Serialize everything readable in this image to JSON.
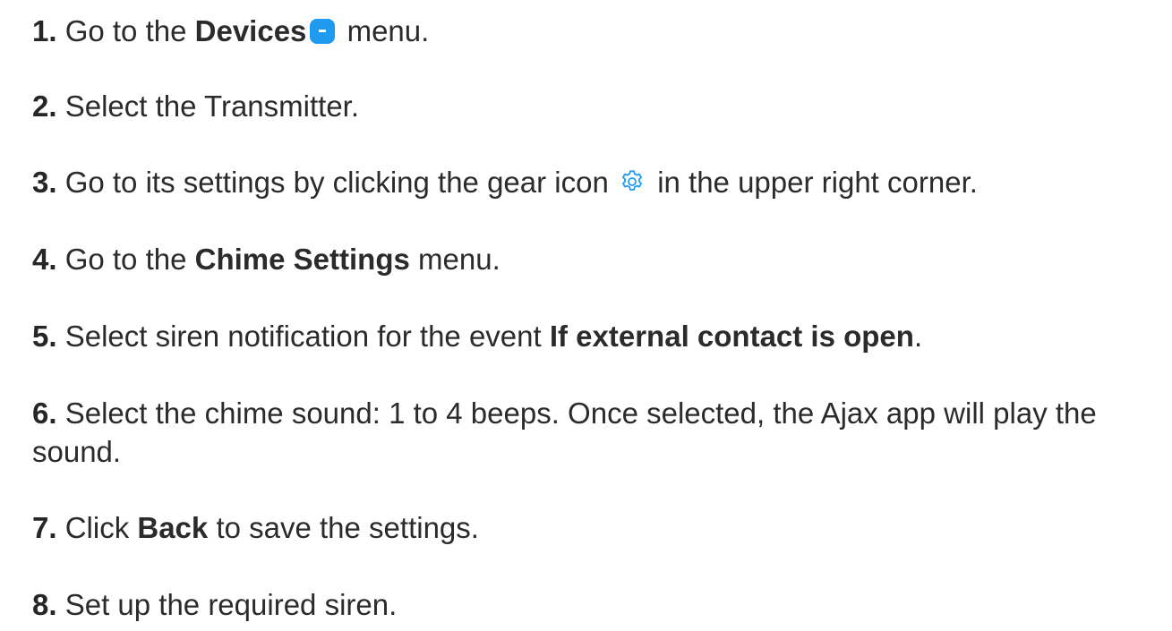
{
  "steps": [
    {
      "number": "1.",
      "text_before": "Go to the",
      "bold": "Devices",
      "icon": "devices-icon",
      "text_after": "menu."
    },
    {
      "number": "2.",
      "text": "Select the Transmitter."
    },
    {
      "number": "3.",
      "text_before": "Go to its settings by clicking the gear icon",
      "icon": "gear-icon",
      "text_after": "in the upper right corner."
    },
    {
      "number": "4.",
      "text_before": "Go to the",
      "bold": "Chime Settings",
      "text_after": "menu."
    },
    {
      "number": "5.",
      "text_before": "Select siren notification for the event",
      "bold": "If external contact is open",
      "text_after": "."
    },
    {
      "number": "6.",
      "text": "Select the chime sound: 1 to 4 beeps. Once selected, the Ajax app will play the sound."
    },
    {
      "number": "7.",
      "text_before": "Click",
      "bold": "Back",
      "text_after": "to save the settings."
    },
    {
      "number": "8.",
      "text": "Set up the required siren."
    }
  ],
  "colors": {
    "text": "#2b2b2b",
    "accent": "#1e9bf0",
    "background": "#ffffff"
  }
}
